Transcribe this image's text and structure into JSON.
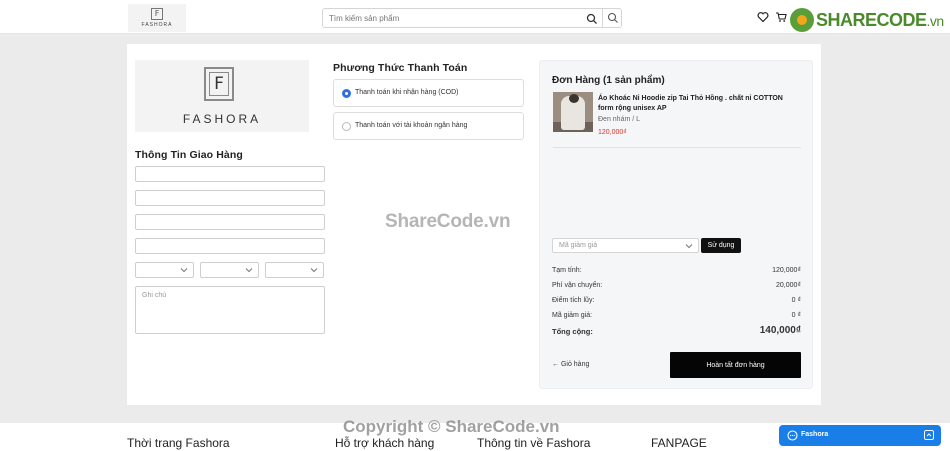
{
  "header": {
    "logo_text": "FASHORA",
    "logo_letter": "F",
    "search_placeholder": "Tìm kiếm sản phẩm"
  },
  "watermark_logo": {
    "name": "SHARECODE",
    "suffix": ".vn"
  },
  "brand": {
    "letter": "F",
    "name": "FASHORA"
  },
  "shipping": {
    "title": "Thông Tin Giao Hàng",
    "note_placeholder": "Ghi chú"
  },
  "payment": {
    "title": "Phương Thức Thanh Toán",
    "options": [
      {
        "label": "Thanh toán khi nhận hàng (COD)",
        "selected": true
      },
      {
        "label": "Thanh toán với tài khoản ngân hàng",
        "selected": false
      }
    ]
  },
  "order": {
    "title": "Đơn Hàng (1 sản phẩm)",
    "item": {
      "name": "Áo Khoác Nỉ Hoodie zip Tai Thỏ Hồng . chất nỉ COTTON form rộng unisex AP",
      "variant": "Đen nhám / L",
      "price": "120,000₫"
    },
    "coupon_placeholder": "Mã giảm giá",
    "apply_label": "Sử dụng",
    "summary": [
      {
        "label": "Tạm tính:",
        "value": "120,000₫"
      },
      {
        "label": "Phí vận chuyển:",
        "value": "20,000₫"
      },
      {
        "label": "Điểm tích lũy:",
        "value": "0 ₫"
      },
      {
        "label": "Mã giảm giá:",
        "value": "0 ₫"
      }
    ],
    "total_label": "Tổng cộng:",
    "total_value": "140,000₫",
    "back_label": "← Giỏ hàng",
    "finish_label": "Hoàn tất đơn hàng"
  },
  "watermark_text": "ShareCode.vn",
  "copyright": "Copyright © ShareCode.vn",
  "footer": {
    "columns": [
      "Thời trang Fashora",
      "Hỗ trợ khách hàng",
      "Thông tin về Fashora",
      "FANPAGE"
    ]
  },
  "chat": {
    "label": "Fashora"
  },
  "colors": {
    "accent": "#2f6fe0",
    "price": "#d9352b",
    "chat": "#1a7ee8"
  }
}
